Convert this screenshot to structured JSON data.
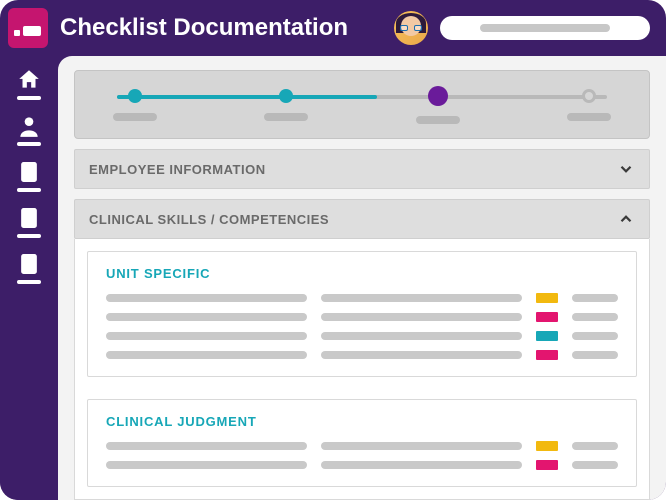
{
  "header": {
    "title": "Checklist Documentation",
    "search_placeholder": ""
  },
  "stepper": {
    "steps": [
      {
        "state": "done",
        "color": "#17a7b7"
      },
      {
        "state": "done",
        "color": "#17a7b7"
      },
      {
        "state": "current",
        "color": "#6a1b9a"
      },
      {
        "state": "pending",
        "color": "#b9b9b9"
      }
    ],
    "progress_color": "#17a7b7"
  },
  "sections": [
    {
      "title": "EMPLOYEE INFORMATION",
      "expanded": false
    },
    {
      "title": "CLINICAL SKILLS / COMPETENCIES",
      "expanded": true
    }
  ],
  "panels": [
    {
      "title": "UNIT SPECIFIC",
      "rows": [
        {
          "status_color": "#f2b90f"
        },
        {
          "status_color": "#e3156f"
        },
        {
          "status_color": "#17a7b7"
        },
        {
          "status_color": "#e3156f"
        }
      ]
    },
    {
      "title": "CLINICAL JUDGMENT",
      "rows": [
        {
          "status_color": "#f2b90f"
        },
        {
          "status_color": "#e3156f"
        }
      ]
    }
  ],
  "colors": {
    "brand_bg": "#3d1e68",
    "logo_bg": "#c5156f",
    "teal": "#17a7b7",
    "purple_dot": "#6a1b9a"
  }
}
